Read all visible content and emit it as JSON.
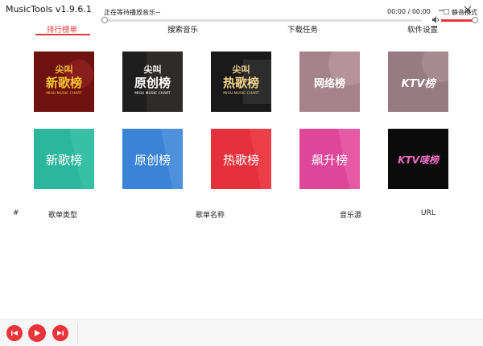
{
  "window": {
    "title": "MusicTools v1.9.6.1"
  },
  "tabs": [
    {
      "label": "排行榜单"
    },
    {
      "label": "搜索音乐"
    },
    {
      "label": "下载任务"
    },
    {
      "label": "软件设置"
    }
  ],
  "charts_row1": [
    {
      "label": "新歌榜",
      "prefix": "尖叫",
      "sub": "MIGU MUSIC CHART",
      "color": "#8a1c1c"
    },
    {
      "label": "原创榜",
      "prefix": "尖叫",
      "sub": "MIGU MUSIC CHART",
      "color": "#2a2a2a"
    },
    {
      "label": "热歌榜",
      "prefix": "尖叫",
      "sub": "MIGU MUSIC CHART",
      "color": "#222"
    },
    {
      "label": "网络榜",
      "color": "#a8868c"
    },
    {
      "label": "KTV榜",
      "color": "#9b8088"
    }
  ],
  "charts_row2": [
    {
      "label": "新歌榜",
      "color": "#2fb8a0"
    },
    {
      "label": "原创榜",
      "color": "#3d86d9"
    },
    {
      "label": "热歌榜",
      "color": "#e8323d"
    },
    {
      "label": "飙升榜",
      "color": "#e0499b"
    },
    {
      "label": "KTV唛榜",
      "color": "#0c0c0c"
    }
  ],
  "table": {
    "headers": [
      "#",
      "歌单类型",
      "歌单名称",
      "音乐源",
      "URL"
    ]
  },
  "player": {
    "status": "正在等待播放音乐~",
    "time": "00:00 / 00:00",
    "mute_label": "静音模式"
  },
  "colors": {
    "accent": "#e23a3a"
  }
}
